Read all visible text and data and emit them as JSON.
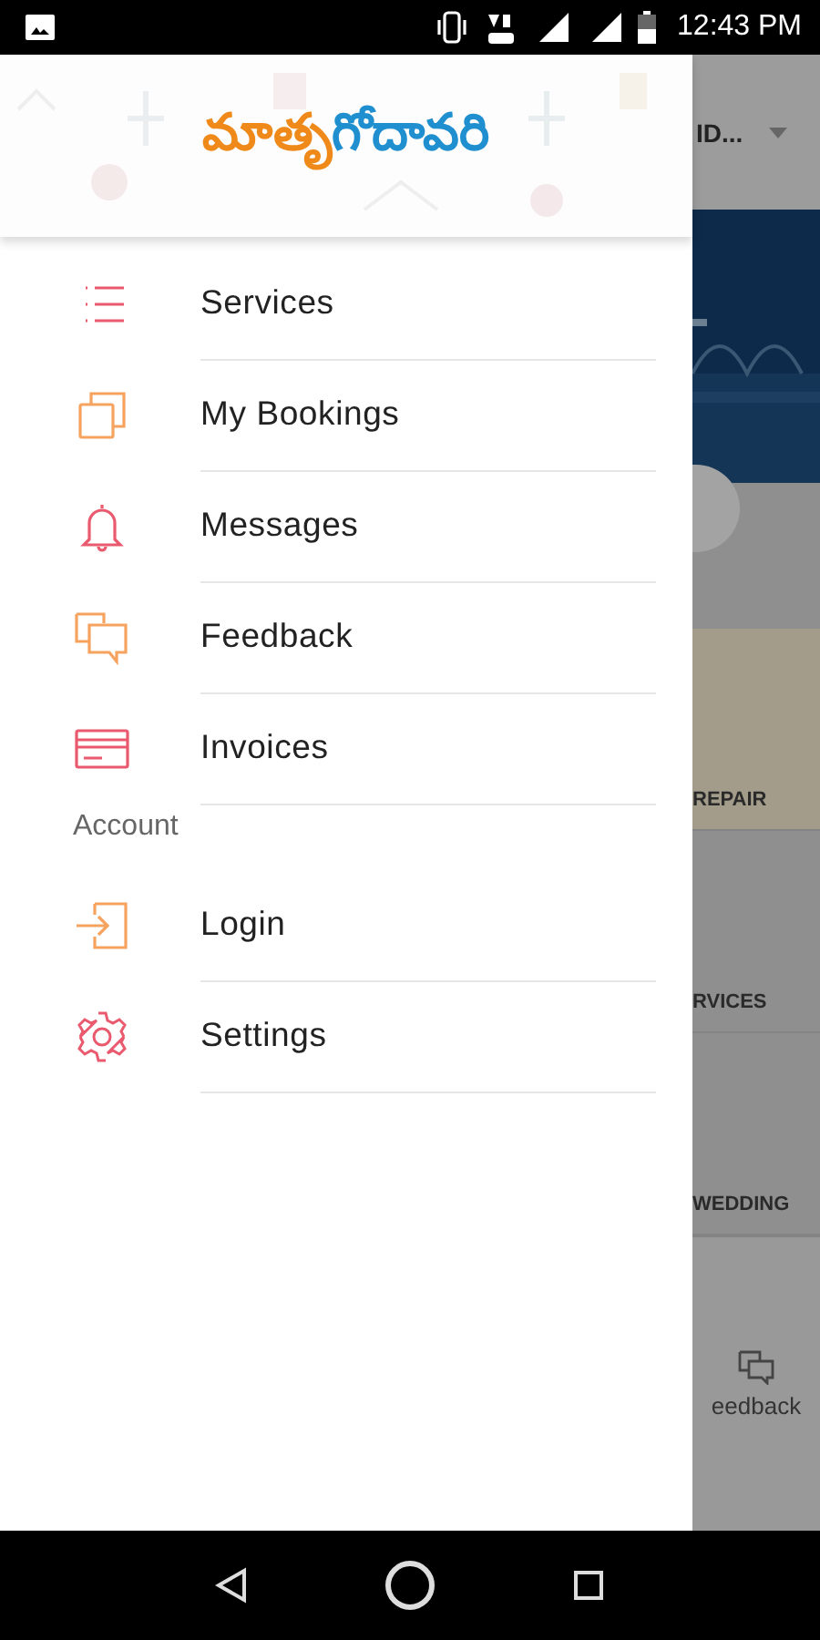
{
  "status_bar": {
    "time": "12:43 PM"
  },
  "drawer": {
    "logo_parts": [
      {
        "text": "మాతృ",
        "color": "#ef8a1a"
      },
      {
        "text": "గోదావరి",
        "color": "#1f8fd0"
      }
    ],
    "sections": [
      {
        "items": [
          {
            "label": "Services",
            "kind": "list"
          },
          {
            "label": "My Bookings",
            "kind": "copies"
          },
          {
            "label": "Messages",
            "kind": "bell"
          },
          {
            "label": "Feedback",
            "kind": "chat"
          },
          {
            "label": "Invoices",
            "kind": "card"
          }
        ]
      },
      {
        "title": "Account",
        "items": [
          {
            "label": "Login",
            "kind": "login"
          },
          {
            "label": "Settings",
            "kind": "gear"
          }
        ]
      }
    ]
  },
  "background": {
    "location": "ID...",
    "tiles": [
      "REPAIR",
      "RVICES",
      "WEDDING"
    ],
    "bottom_tab": "eedback"
  }
}
